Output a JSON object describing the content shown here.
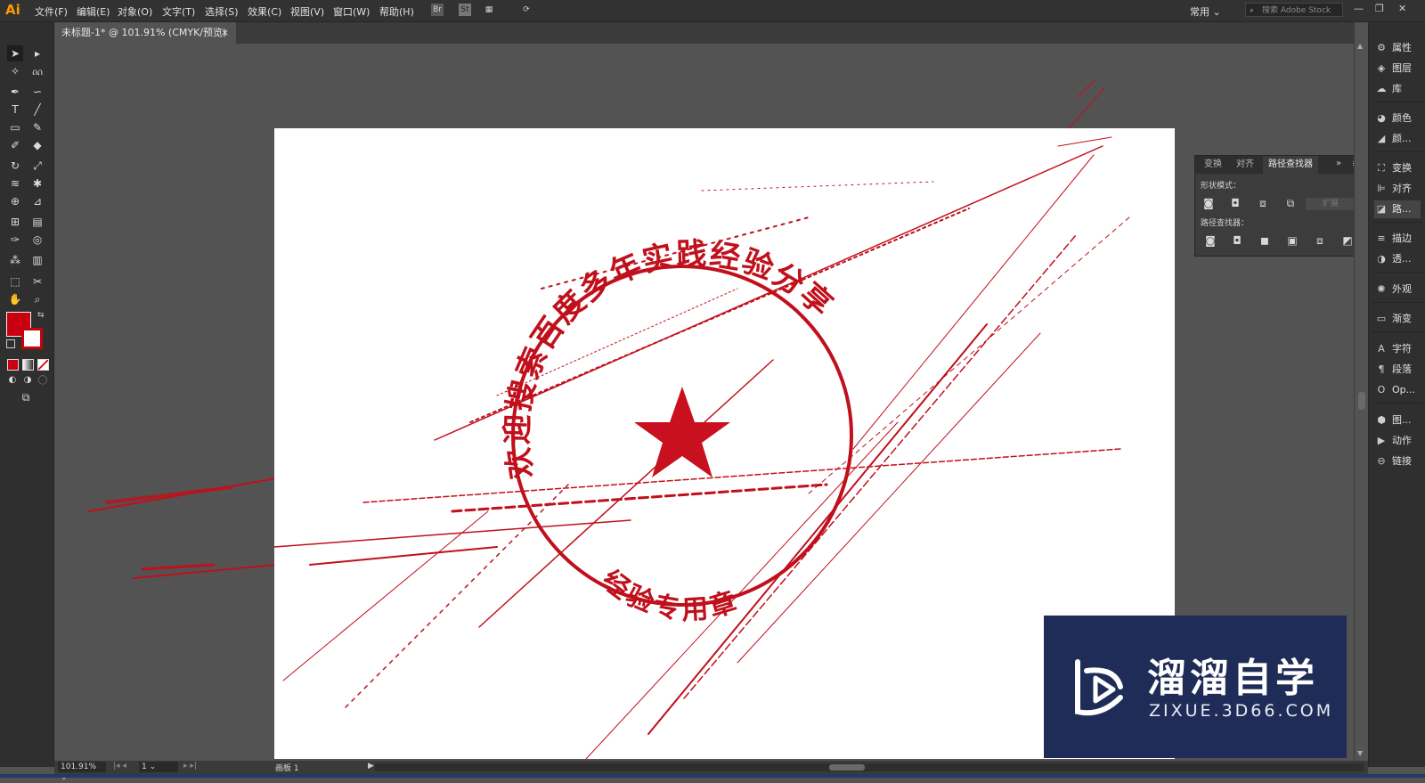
{
  "app": {
    "logo": "Ai"
  },
  "menubar": {
    "items": [
      "文件(F)",
      "编辑(E)",
      "对象(O)",
      "文字(T)",
      "选择(S)",
      "效果(C)",
      "视图(V)",
      "窗口(W)",
      "帮助(H)"
    ],
    "bridge_label": "Br",
    "stock_label": "St",
    "workspace": "常用",
    "search_placeholder": "搜索 Adobe Stock",
    "window_controls": [
      "—",
      "❐",
      "✕"
    ]
  },
  "document": {
    "tab_title": "未标题-1* @ 101.91% (CMYK/预览)",
    "close": "×"
  },
  "tools": [
    "selection-tool",
    "direct-selection-tool",
    "magic-wand-tool",
    "lasso-tool",
    "pen-tool",
    "curvature-tool",
    "type-tool",
    "line-tool",
    "rectangle-tool",
    "paintbrush-tool",
    "shaper-tool",
    "eraser-tool",
    "rotate-tool",
    "scale-tool",
    "width-tool",
    "puppet-warp-tool",
    "shape-builder-tool",
    "perspective-grid-tool",
    "mesh-tool",
    "gradient-tool",
    "eyedropper-tool",
    "blend-tool",
    "symbol-sprayer-tool",
    "column-graph-tool",
    "artboard-tool",
    "slice-tool",
    "hand-tool",
    "zoom-tool"
  ],
  "colors": {
    "fill": "#c8000f",
    "accent": "#c8101e",
    "stamp": "#c0101c",
    "watermark_bg": "#1e2c57"
  },
  "stamp": {
    "top_text": "欢迎搜索百度多年实践经验分享",
    "bottom_text": "经验专用章"
  },
  "pathfinder_panel": {
    "tabs": [
      "变换",
      "对齐",
      "路径查找器"
    ],
    "shape_modes_label": "形状模式：",
    "pathfinders_label": "路径查找器：",
    "expand_label": "扩展"
  },
  "right_panel": {
    "items": [
      "属性",
      "图层",
      "库",
      "颜色",
      "颜...",
      "变换",
      "对齐",
      "路...",
      "描边",
      "透...",
      "外观",
      "渐变",
      "字符",
      "段落",
      "Op...",
      "图...",
      "动作",
      "链接"
    ]
  },
  "statusbar": {
    "zoom": "101.91%",
    "artboard_num": "1",
    "artboard_label": "画板 1"
  },
  "watermark": {
    "title": "溜溜自学",
    "url": "ZIXUE.3D66.COM"
  }
}
